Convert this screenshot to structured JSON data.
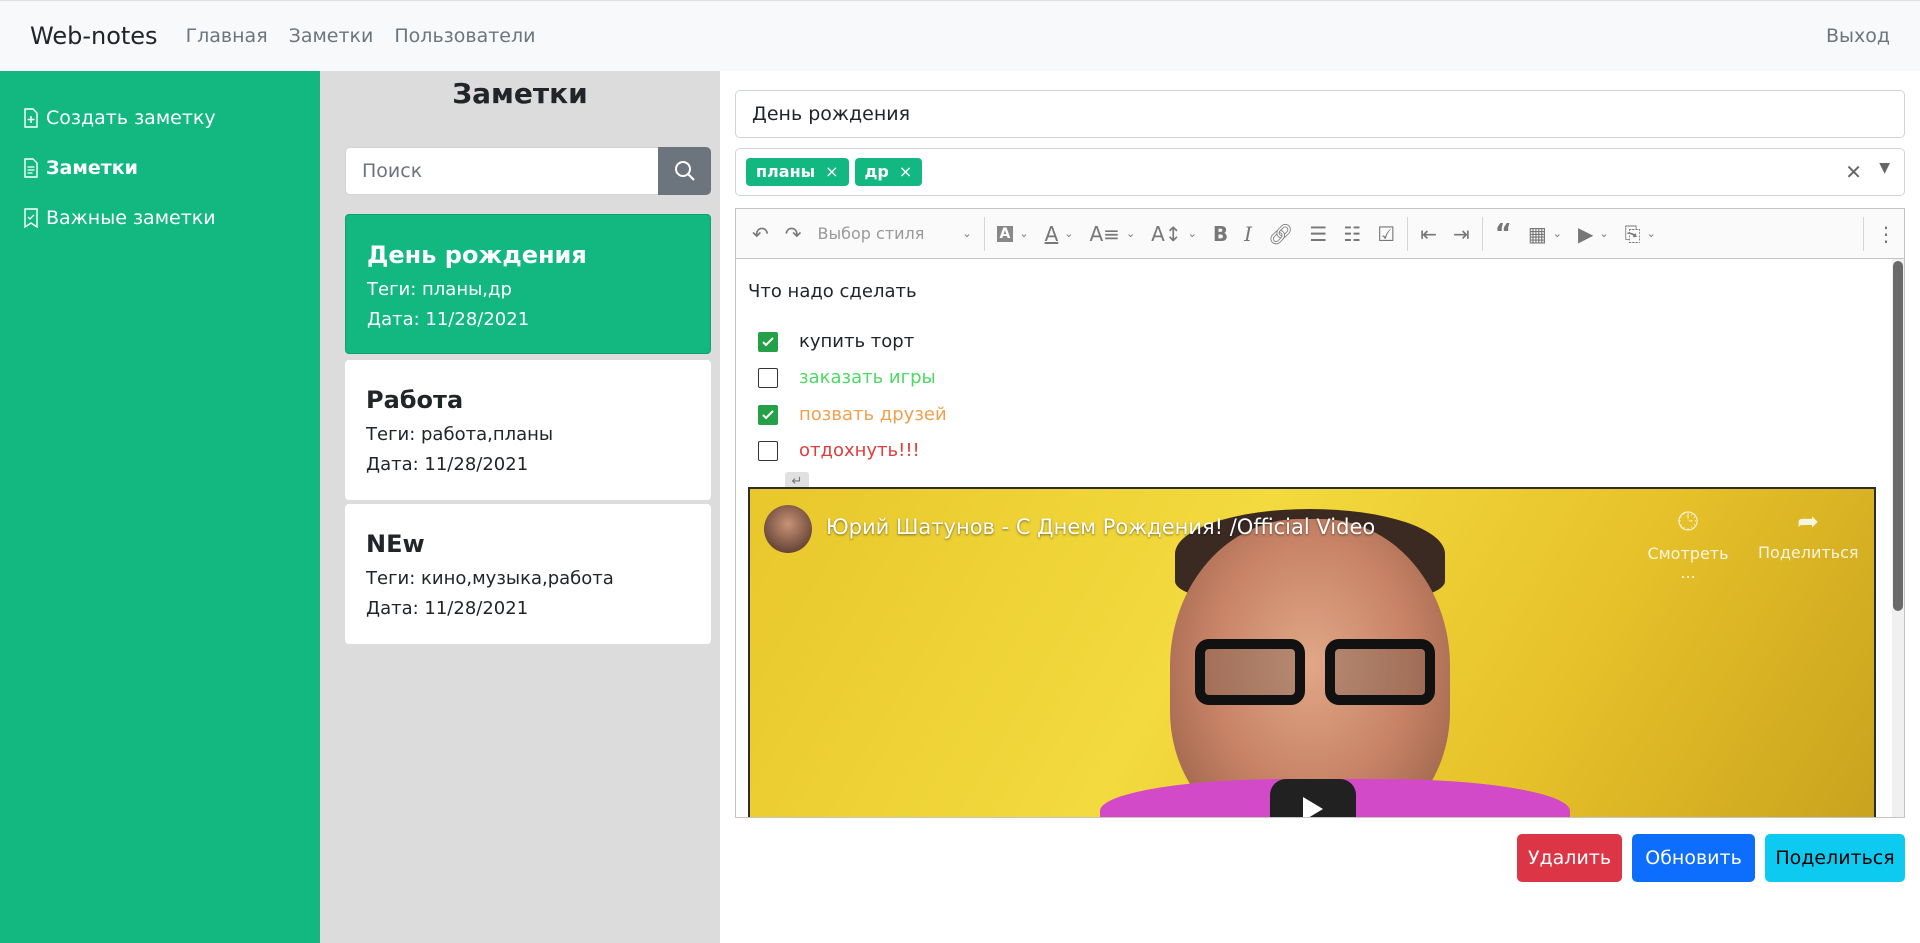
{
  "nav": {
    "brand": "Web-notes",
    "links": [
      "Главная",
      "Заметки",
      "Пользователи"
    ],
    "logout": "Выход"
  },
  "sidebar": {
    "items": [
      {
        "label": "Создать заметку",
        "icon": "file-plus-icon"
      },
      {
        "label": "Заметки",
        "icon": "file-text-icon",
        "active": true
      },
      {
        "label": "Важные заметки",
        "icon": "bookmark-icon"
      }
    ]
  },
  "notes_panel": {
    "title": "Заметки",
    "search_placeholder": "Поиск",
    "notes": [
      {
        "title": "День рождения",
        "tags": "Теги: планы,др",
        "date": "Дата: 11/28/2021",
        "active": true
      },
      {
        "title": "Работа",
        "tags": "Теги: работа,планы",
        "date": "Дата: 11/28/2021"
      },
      {
        "title": "NEw",
        "tags": "Теги: кино,музыка,работа",
        "date": "Дата: 11/28/2021"
      }
    ]
  },
  "editor": {
    "note_title": "День рождения",
    "tags": [
      "планы",
      "др"
    ],
    "toolbar": {
      "style_select": "Выбор стиля"
    },
    "content_heading": "Что надо сделать",
    "todos": [
      {
        "text": "купить торт",
        "checked": true,
        "color": "#212529"
      },
      {
        "text": "заказать игры",
        "checked": false,
        "color": "#4cd964"
      },
      {
        "text": "позвать друзей",
        "checked": true,
        "color": "#f0a050"
      },
      {
        "text": "отдохнуть!!!",
        "checked": false,
        "color": "#e03c3c"
      }
    ],
    "video": {
      "title": "Юрий Шатунов - С Днем Рождения! /Official Video",
      "watch_later": "Смотреть ...",
      "share": "Поделиться"
    }
  },
  "actions": {
    "delete": "Удалить",
    "update": "Обновить",
    "share": "Поделиться"
  },
  "colors": {
    "accent": "#12b880",
    "danger": "#dc3545",
    "primary": "#0d6efd",
    "info": "#0dcaf0"
  }
}
